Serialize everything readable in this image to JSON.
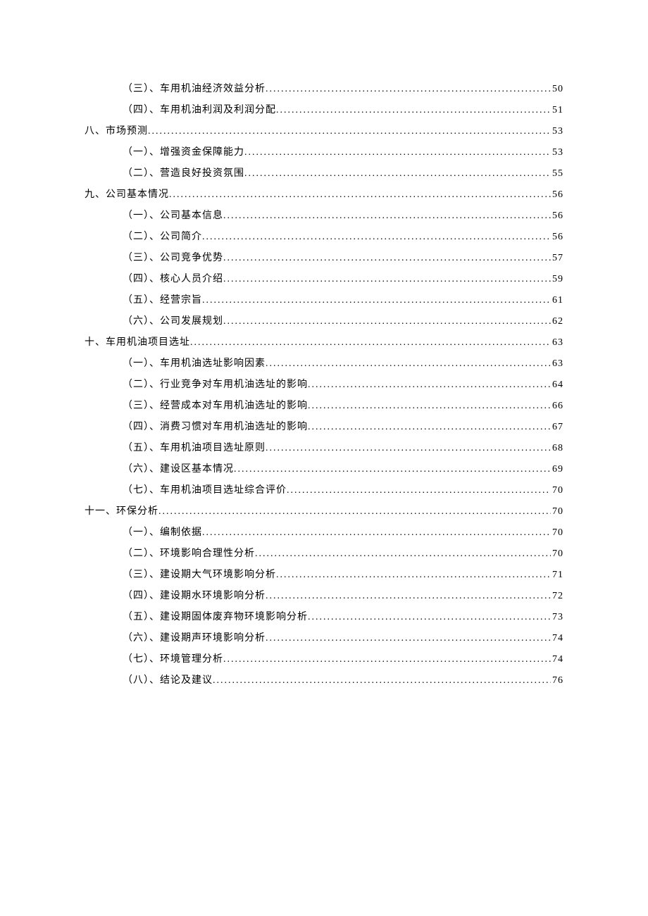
{
  "toc": [
    {
      "level": "sub",
      "title": "（三）、车用机油经济效益分析",
      "page": "50"
    },
    {
      "level": "sub",
      "title": "（四）、车用机油利润及利润分配",
      "page": "51"
    },
    {
      "level": "main",
      "title": "八、市场预测",
      "page": "53"
    },
    {
      "level": "sub",
      "title": "（一）、增强资金保障能力",
      "page": "53"
    },
    {
      "level": "sub",
      "title": "（二）、营造良好投资氛围",
      "page": "55"
    },
    {
      "level": "main",
      "title": "九、公司基本情况",
      "page": "56"
    },
    {
      "level": "sub",
      "title": "（一）、公司基本信息",
      "page": "56"
    },
    {
      "level": "sub",
      "title": "（二）、公司简介",
      "page": "56"
    },
    {
      "level": "sub",
      "title": "（三）、公司竞争优势",
      "page": "57"
    },
    {
      "level": "sub",
      "title": "（四）、核心人员介绍",
      "page": "59"
    },
    {
      "level": "sub",
      "title": "（五）、经营宗旨",
      "page": "61"
    },
    {
      "level": "sub",
      "title": "（六）、公司发展规划",
      "page": "62"
    },
    {
      "level": "main",
      "title": "十、车用机油项目选址",
      "page": "63"
    },
    {
      "level": "sub",
      "title": "（一）、车用机油选址影响因素",
      "page": "63"
    },
    {
      "level": "sub",
      "title": "（二）、行业竞争对车用机油选址的影响",
      "page": "64"
    },
    {
      "level": "sub",
      "title": "（三）、经营成本对车用机油选址的影响",
      "page": "66"
    },
    {
      "level": "sub",
      "title": "（四）、消费习惯对车用机油选址的影响",
      "page": "67"
    },
    {
      "level": "sub",
      "title": "（五）、车用机油项目选址原则",
      "page": "68"
    },
    {
      "level": "sub",
      "title": "（六）、建设区基本情况",
      "page": "69"
    },
    {
      "level": "sub",
      "title": "（七）、车用机油项目选址综合评价",
      "page": "70"
    },
    {
      "level": "main",
      "title": "十一、环保分析",
      "page": "70"
    },
    {
      "level": "sub",
      "title": "（一）、编制依据",
      "page": "70"
    },
    {
      "level": "sub",
      "title": "（二）、环境影响合理性分析",
      "page": "70"
    },
    {
      "level": "sub",
      "title": "（三）、建设期大气环境影响分析",
      "page": "71"
    },
    {
      "level": "sub",
      "title": "（四）、建设期水环境影响分析",
      "page": "72"
    },
    {
      "level": "sub",
      "title": "（五）、建设期固体废弃物环境影响分析",
      "page": "73"
    },
    {
      "level": "sub",
      "title": "（六）、建设期声环境影响分析",
      "page": "74"
    },
    {
      "level": "sub",
      "title": "（七）、环境管理分析",
      "page": "74"
    },
    {
      "level": "sub",
      "title": "（八）、结论及建议",
      "page": "76"
    }
  ]
}
